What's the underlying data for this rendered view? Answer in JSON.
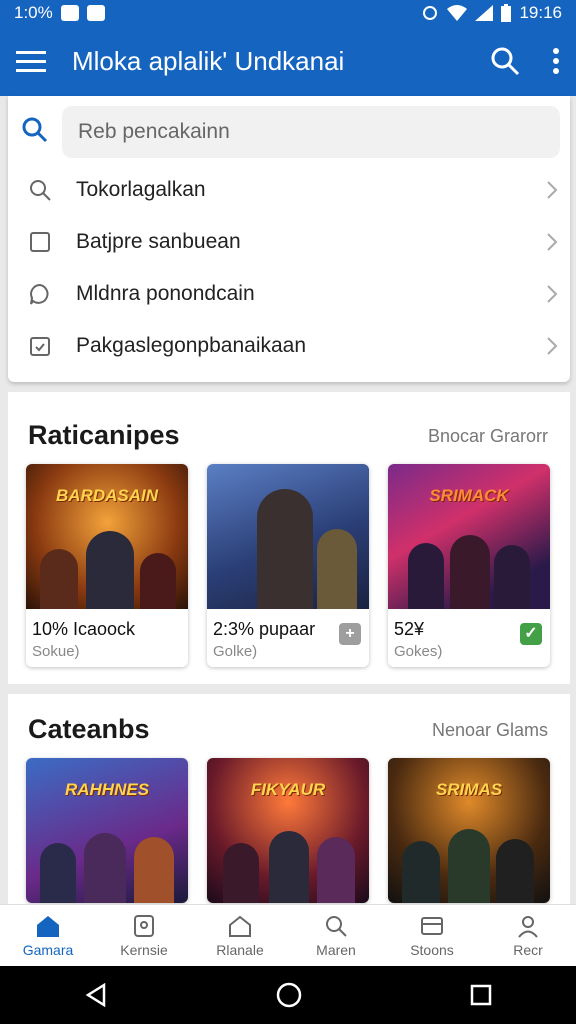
{
  "status_bar": {
    "time_left": "1:0%",
    "time_right": "19:16"
  },
  "app_bar": {
    "title": "Mloka aplalik' Undkanai",
    "menu_icon": "hamburger-icon",
    "search_icon": "search-icon",
    "more_icon": "more-vert-icon"
  },
  "search": {
    "placeholder": "Reb pencakainn"
  },
  "menu": {
    "items": [
      {
        "label": "Tokorlagalkan",
        "icon": "search-icon"
      },
      {
        "label": "Batjpre sanbuean",
        "icon": "square-icon"
      },
      {
        "label": "Mldnra ponondcain",
        "icon": "chat-bubble-icon"
      },
      {
        "label": "Pakgaslegonpbanaikaan",
        "icon": "calendar-check-icon"
      }
    ]
  },
  "section1": {
    "title": "Raticanipes",
    "link": "Bnocar Grarorr",
    "cards": [
      {
        "logo": "BARDASAIN",
        "pct": "10% Icaoock",
        "sub": "Sokue)",
        "badge": "",
        "badge_color": ""
      },
      {
        "logo": "",
        "pct": "2:3% pupaar",
        "sub": "Golke)",
        "badge": "+",
        "badge_color": "#9e9e9e"
      },
      {
        "logo": "SRIMACK",
        "pct": "52¥",
        "sub": "Gokes)",
        "badge": "✓",
        "badge_color": "#43a047"
      }
    ]
  },
  "section2": {
    "title": "Cateanbs",
    "link": "Nenoar Glams",
    "cards": [
      {
        "logo": "RAHHNES"
      },
      {
        "logo": "FIKYAUR"
      },
      {
        "logo": "SRIMAS"
      }
    ]
  },
  "bottom_nav": {
    "items": [
      {
        "label": "Gamara",
        "icon": "home-icon",
        "active": true
      },
      {
        "label": "Kernsie",
        "icon": "tablet-icon",
        "active": false
      },
      {
        "label": "Rlanale",
        "icon": "house-outline-icon",
        "active": false
      },
      {
        "label": "Maren",
        "icon": "search-icon",
        "active": false
      },
      {
        "label": "Stoons",
        "icon": "store-icon",
        "active": false
      },
      {
        "label": "Recr",
        "icon": "person-icon",
        "active": false
      }
    ]
  },
  "colors": {
    "primary": "#1565c0",
    "card_badge_green": "#43a047"
  }
}
